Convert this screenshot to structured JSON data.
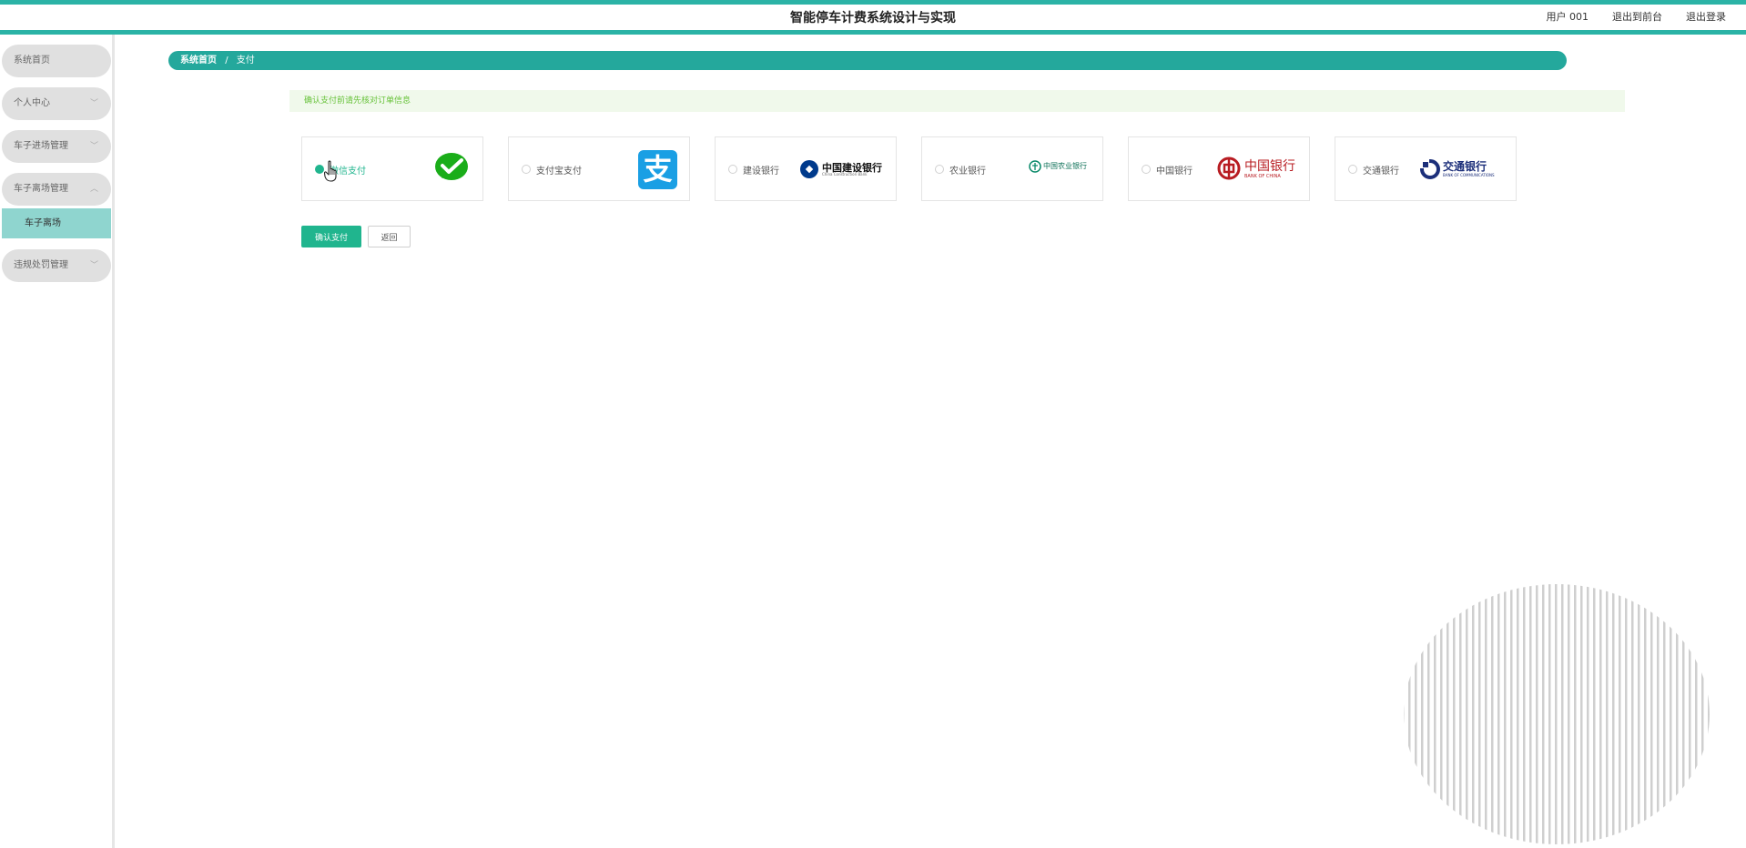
{
  "header": {
    "title": "智能停车计费系统设计与实现",
    "user_label": "用户 001",
    "front_link": "退出到前台",
    "logout_link": "退出登录"
  },
  "sidebar": {
    "items": [
      {
        "label": "系统首页",
        "has_chevron": false
      },
      {
        "label": "个人中心",
        "has_chevron": true
      },
      {
        "label": "车子进场管理",
        "has_chevron": true
      },
      {
        "label": "车子离场管理",
        "has_chevron": true,
        "expanded": true
      },
      {
        "label": "违规处罚管理",
        "has_chevron": true
      }
    ],
    "sub_items": [
      {
        "label": "车子离场",
        "active": true
      }
    ]
  },
  "breadcrumb": {
    "home": "系统首页",
    "separator": "/",
    "current": "支付"
  },
  "notice": "确认支付前请先核对订单信息",
  "payment": {
    "options": [
      {
        "label": "微信支付",
        "selected": true,
        "logo": "wechat-pay-icon"
      },
      {
        "label": "支付宝支付",
        "selected": false,
        "logo": "alipay-icon"
      },
      {
        "label": "建设银行",
        "selected": false,
        "logo": "ccb-logo"
      },
      {
        "label": "农业银行",
        "selected": false,
        "logo": "abc-logo"
      },
      {
        "label": "中国银行",
        "selected": false,
        "logo": "boc-logo"
      },
      {
        "label": "交通银行",
        "selected": false,
        "logo": "bocom-logo"
      }
    ],
    "logo_text": {
      "alipay": "支",
      "ccb_cn": "中国建设银行",
      "ccb_en": "China Construction Bank",
      "abc_cn": "中国农业银行",
      "boc_cn": "中国银行",
      "boc_en": "BANK OF CHINA",
      "bocom_cn": "交通银行",
      "bocom_en": "BANK OF COMMUNICATIONS"
    }
  },
  "actions": {
    "confirm": "确认支付",
    "back": "返回"
  },
  "colors": {
    "accent": "#24a89c",
    "primary": "#20b58e",
    "notice_bg": "#f0f9eb",
    "notice_text": "#67c23a"
  }
}
